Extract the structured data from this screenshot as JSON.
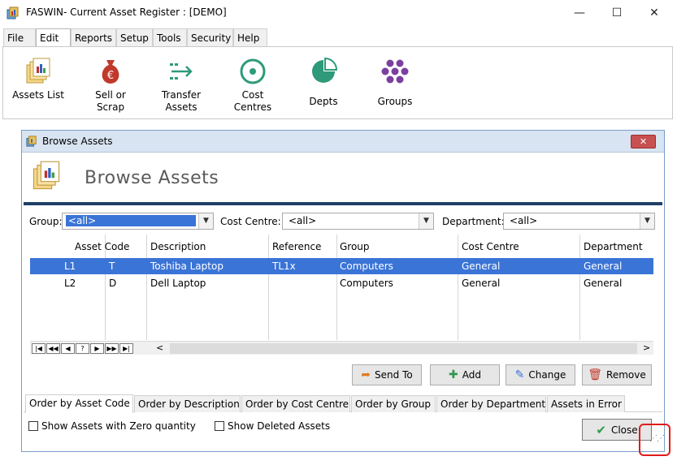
{
  "window": {
    "title": "FASWIN- Current Asset Register : [DEMO]",
    "controls": {
      "minimize": "—",
      "maximize": "☐",
      "close": "✕"
    }
  },
  "menu": {
    "tabs": [
      "File",
      "Edit",
      "Reports",
      "Setup",
      "Tools",
      "Security",
      "Help"
    ],
    "active": "Edit"
  },
  "ribbon": {
    "buttons": [
      {
        "label_line1": "Assets List",
        "label_line2": "",
        "icon": "assets-list-icon"
      },
      {
        "label_line1": "Sell or",
        "label_line2": "Scrap",
        "icon": "money-bag-euro-icon"
      },
      {
        "label_line1": "Transfer",
        "label_line2": "Assets",
        "icon": "transfer-arrows-icon"
      },
      {
        "label_line1": "Cost",
        "label_line2": "Centres",
        "icon": "target-icon"
      },
      {
        "label_line1": "Depts",
        "label_line2": "",
        "icon": "pie-chart-icon"
      },
      {
        "label_line1": "Groups",
        "label_line2": "",
        "icon": "hexagon-cluster-icon"
      }
    ]
  },
  "browse": {
    "window_title": "Browse Assets",
    "heading": "Browse Assets",
    "close_glyph": "✕",
    "filters": {
      "group_label": "Group:",
      "group_value": "<all>",
      "cost_centre_label": "Cost Centre:",
      "cost_centre_value": "<all>",
      "department_label": "Department:",
      "department_value": "<all>"
    },
    "grid": {
      "headers": [
        "Asset Code",
        "Description",
        "Reference",
        "Group",
        "Cost Centre",
        "Department"
      ],
      "rows": [
        {
          "id": "L1",
          "code": "T",
          "description": "Toshiba Laptop",
          "reference": "TL1x",
          "group": "Computers",
          "cost_centre": "General",
          "department": "General",
          "selected": true
        },
        {
          "id": "L2",
          "code": "D",
          "description": "Dell Laptop",
          "reference": "",
          "group": "Computers",
          "cost_centre": "General",
          "department": "General",
          "selected": false
        }
      ],
      "nav": [
        "|◀",
        "◀◀",
        "◀",
        "?",
        "▶",
        "▶▶",
        "▶|"
      ],
      "scroll_left": "<",
      "scroll_right": ">"
    },
    "actions": {
      "send_to": "Send To",
      "add": "Add",
      "change": "Change",
      "remove": "Remove"
    },
    "order_tabs": [
      "Order by Asset Code",
      "Order by Description",
      "Order by Cost Centre",
      "Order by Group",
      "Order by Department",
      "Assets in Error"
    ],
    "active_order_tab": "Order by Asset Code",
    "checkboxes": {
      "zero_qty": "Show Assets with Zero quantity",
      "deleted": "Show Deleted Assets"
    },
    "close_label": "Close"
  },
  "colors": {
    "selection": "#3a74d6",
    "header_rule": "#1f3f66",
    "highlight": "#e01b1b",
    "teal": "#2e9a7a",
    "sell_red": "#c0392b",
    "groups_purple": "#7b3fa0"
  }
}
